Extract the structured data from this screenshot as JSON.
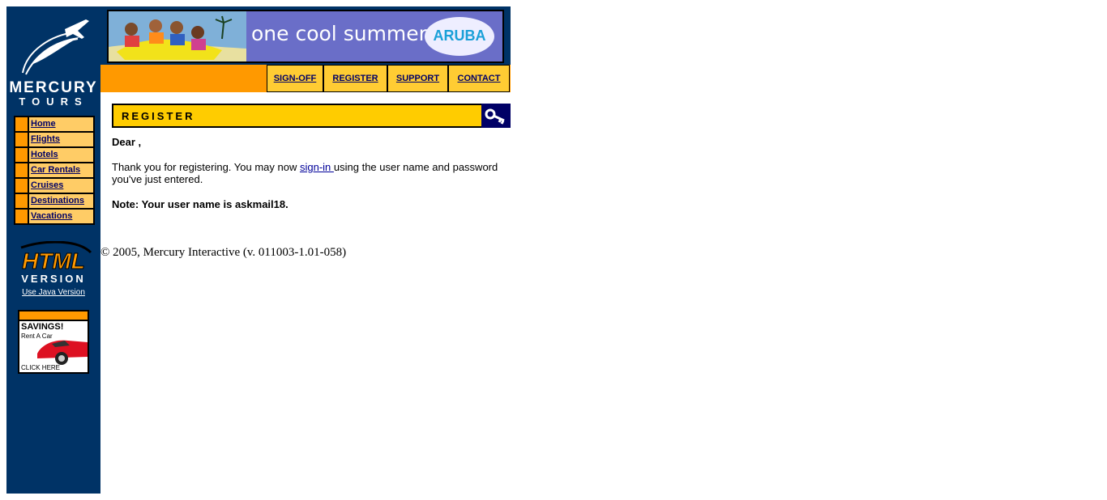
{
  "brand": {
    "name": "MERCURY",
    "subname": "TOURS"
  },
  "banner": {
    "tagline": "one cool summer",
    "sponsor": "ARUBA"
  },
  "top_nav": [
    {
      "label": "SIGN-OFF",
      "key": "signoff"
    },
    {
      "label": "REGISTER",
      "key": "register"
    },
    {
      "label": "SUPPORT",
      "key": "support"
    },
    {
      "label": "CONTACT",
      "key": "contact"
    }
  ],
  "sidebar": {
    "items": [
      {
        "label": "Home"
      },
      {
        "label": "Flights"
      },
      {
        "label": "Hotels"
      },
      {
        "label": "Car Rentals"
      },
      {
        "label": "Cruises"
      },
      {
        "label": "Destinations"
      },
      {
        "label": "Vacations"
      }
    ],
    "html_version": {
      "line1": "HTML",
      "line2": "VERSION"
    },
    "java_link": "Use Java Version",
    "ad": {
      "headline": "SAVINGS!",
      "sub": "Rent A Car",
      "cta": "CLICK HERE"
    }
  },
  "page": {
    "header": "REGISTER",
    "greeting": "Dear ,",
    "thanks_before": "Thank you for registering. You may now ",
    "signin_link": "sign-in ",
    "thanks_after": "using the user name and password you've just entered.",
    "note": "Note: Your user name is askmail18."
  },
  "footer": "© 2005, Mercury Interactive (v. 011003-1.01-058)",
  "colors": {
    "navy": "#003366",
    "orange": "#ff9900",
    "yellow": "#ffcc00",
    "light_orange": "#ffcc66",
    "link": "#000066"
  },
  "icons": [
    "plane-logo-icon",
    "key-icon",
    "car-icon"
  ]
}
